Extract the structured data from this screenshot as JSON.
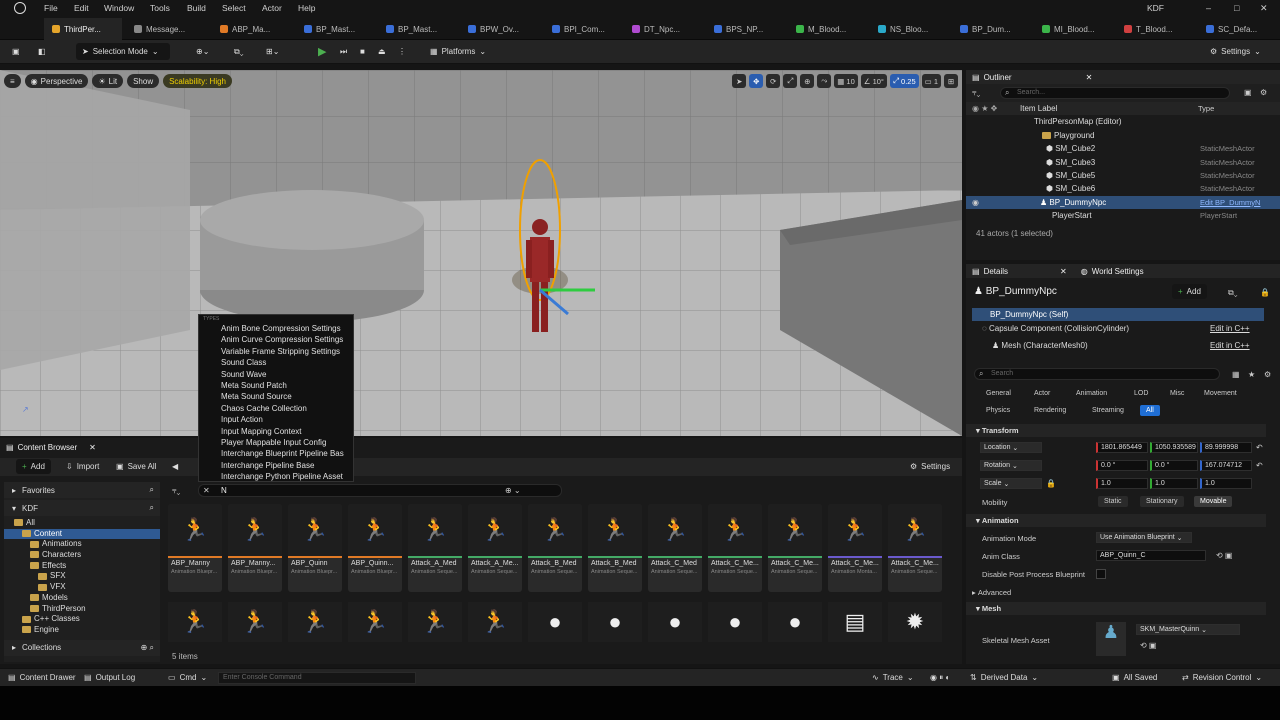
{
  "menu": {
    "items": [
      "File",
      "Edit",
      "Window",
      "Tools",
      "Build",
      "Select",
      "Actor",
      "Help"
    ],
    "project": "KDF"
  },
  "tabs": [
    "ThirdPer...",
    "Message...",
    "ABP_Ma...",
    "BP_Mast...",
    "BP_Mast...",
    "BPW_Ov...",
    "BPI_Com...",
    "DT_Npc...",
    "BPS_NP...",
    "M_Blood...",
    "NS_Bloo...",
    "BP_Dum...",
    "MI_Blood...",
    "T_Blood...",
    "SC_Defa..."
  ],
  "toolbar": {
    "mode": "Selection Mode",
    "platforms": "Platforms",
    "settings": "Settings"
  },
  "viewport": {
    "perspective": "Perspective",
    "lit": "Lit",
    "show": "Show",
    "scalability": "Scalability: High",
    "grid": "10",
    "angle": "10°",
    "scale": "0.25",
    "cams": "1"
  },
  "dropdown": {
    "header": "TYPES",
    "items": [
      "Anim Bone Compression Settings",
      "Anim Curve Compression Settings",
      "Variable Frame Stripping Settings",
      "Sound Class",
      "Sound Wave",
      "Meta Sound Patch",
      "Meta Sound Source",
      "Chaos Cache Collection",
      "Input Action",
      "Input Mapping Context",
      "Player Mappable Input Config",
      "Interchange Blueprint Pipeline Bas",
      "Interchange Pipeline Base",
      "Interchange Python Pipeline Asset"
    ]
  },
  "content_browser": {
    "tab": "Content Browser",
    "add": "Add",
    "import": "Import",
    "save_all": "Save All",
    "settings": "Settings",
    "favorites": "Favorites",
    "kdf": "KDF",
    "collections": "Collections",
    "filter_text": "N",
    "items_count": "5 items",
    "tree": [
      "All",
      "Content",
      "Animations",
      "Characters",
      "Effects",
      "SFX",
      "VFX",
      "Models",
      "ThirdPerson",
      "C++ Classes",
      "Engine"
    ],
    "assets_row1": [
      {
        "name": "ABP_Manny",
        "type": "Animation Bluepr..."
      },
      {
        "name": "ABP_Manny...",
        "type": "Animation Bluepr..."
      },
      {
        "name": "ABP_Quinn",
        "type": "Animation Bluepr..."
      },
      {
        "name": "ABP_Quinn...",
        "type": "Animation Bluepr..."
      },
      {
        "name": "Attack_A_Med",
        "type": "Animation Seque..."
      },
      {
        "name": "Attack_A_Me...",
        "type": "Animation Seque..."
      },
      {
        "name": "Attack_B_Med",
        "type": "Animation Seque..."
      },
      {
        "name": "Attack_B_Med",
        "type": "Animation Seque..."
      },
      {
        "name": "Attack_C_Med",
        "type": "Animation Seque..."
      },
      {
        "name": "Attack_C_Me...",
        "type": "Animation Seque..."
      },
      {
        "name": "Attack_C_Me...",
        "type": "Animation Seque..."
      },
      {
        "name": "Attack_C_Me...",
        "type": "Animation Monta..."
      },
      {
        "name": "Attack_C_Me...",
        "type": "Animation Seque..."
      }
    ]
  },
  "outliner": {
    "title": "Outliner",
    "search_placeholder": "Search...",
    "col_label": "Item Label",
    "col_type": "Type",
    "rows": [
      {
        "label": "ThirdPersonMap (Editor)",
        "type": ""
      },
      {
        "label": "Playground",
        "type": ""
      },
      {
        "label": "SM_Cube2",
        "type": "StaticMeshActor"
      },
      {
        "label": "SM_Cube3",
        "type": "StaticMeshActor"
      },
      {
        "label": "SM_Cube5",
        "type": "StaticMeshActor"
      },
      {
        "label": "SM_Cube6",
        "type": "StaticMeshActor"
      },
      {
        "label": "BP_DummyNpc",
        "type": "Edit BP_DummyN"
      },
      {
        "label": "PlayerStart",
        "type": "PlayerStart"
      }
    ],
    "count": "41 actors (1 selected)"
  },
  "details": {
    "tab": "Details",
    "tab2": "World Settings",
    "actor": "BP_DummyNpc",
    "add": "Add",
    "self": "BP_DummyNpc (Self)",
    "capsule": "Capsule Component (CollisionCylinder)",
    "mesh": "Mesh (CharacterMesh0)",
    "edit_cpp": "Edit in C++",
    "search_placeholder": "Search",
    "filters": [
      "General",
      "Actor",
      "Animation",
      "LOD",
      "Misc",
      "Movement",
      "Physics",
      "Rendering",
      "Streaming",
      "All"
    ],
    "transform": "Transform",
    "location": "Location",
    "rotation": "Rotation",
    "scale": "Scale",
    "loc": [
      "1801.865449",
      "1050.935589",
      "89.999998"
    ],
    "rot": [
      "0.0 °",
      "0.0 °",
      "167.074712"
    ],
    "scl": [
      "1.0",
      "1.0",
      "1.0"
    ],
    "mobility": "Mobility",
    "static": "Static",
    "stationary": "Stationary",
    "movable": "Movable",
    "animation": "Animation",
    "anim_mode_label": "Animation Mode",
    "anim_mode": "Use Animation Blueprint",
    "anim_class_label": "Anim Class",
    "anim_class": "ABP_Quinn_C",
    "disable_pp": "Disable Post Process Blueprint",
    "advanced": "Advanced",
    "mesh_sect": "Mesh",
    "skel_label": "Skeletal Mesh Asset",
    "skel": "SKM_MasterQuinn"
  },
  "statusbar": {
    "drawer": "Content Drawer",
    "output": "Output Log",
    "cmd": "Cmd",
    "console_placeholder": "Enter Console Command",
    "trace": "Trace",
    "derived": "Derived Data",
    "saved": "All Saved",
    "revision": "Revision Control"
  }
}
